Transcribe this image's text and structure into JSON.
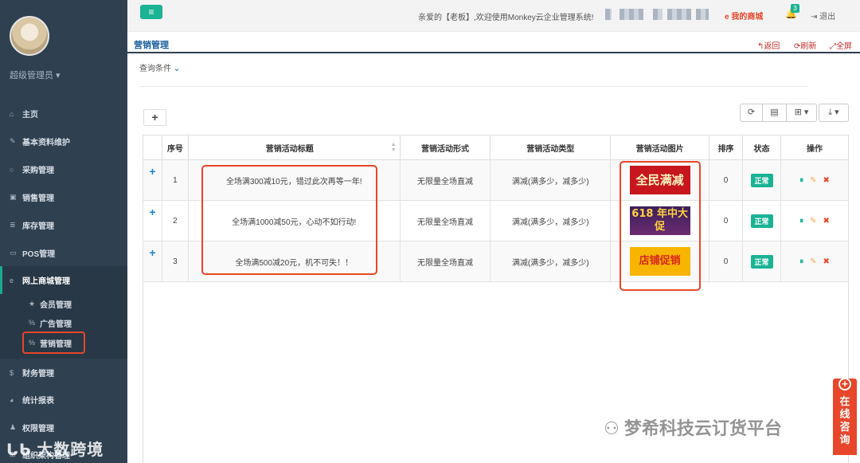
{
  "sidebar": {
    "role": "超级管理员",
    "items": [
      {
        "icon": "home-icon",
        "glyph": "⌂",
        "label": "主页"
      },
      {
        "icon": "pencil-icon",
        "glyph": "✎",
        "label": "基本资料维护"
      },
      {
        "icon": "circle-icon",
        "glyph": "○",
        "label": "采购管理"
      },
      {
        "icon": "money-icon",
        "glyph": "▣",
        "label": "销售管理"
      },
      {
        "icon": "database-icon",
        "glyph": "≣",
        "label": "库存管理"
      },
      {
        "icon": "desktop-icon",
        "glyph": "▭",
        "label": "POS管理"
      },
      {
        "icon": "ie-icon",
        "glyph": "e",
        "label": "网上商城管理"
      },
      {
        "icon": "dollar-icon",
        "glyph": "$",
        "label": "财务管理"
      },
      {
        "icon": "pie-chart-icon",
        "glyph": "◕",
        "label": "统计报表"
      },
      {
        "icon": "user-icon",
        "glyph": "♟",
        "label": "权限管理"
      },
      {
        "icon": "sitemap-icon",
        "glyph": "⊞",
        "label": "组织架构管理"
      }
    ],
    "subitems": [
      {
        "icon": "star-icon",
        "glyph": "★",
        "label": "会员管理"
      },
      {
        "icon": "link-icon",
        "glyph": "%",
        "label": "广告管理"
      },
      {
        "icon": "link-icon",
        "glyph": "%",
        "label": "营销管理"
      }
    ],
    "watermark": "大数跨境"
  },
  "topbar": {
    "menu_glyph": "≡",
    "welcome": "亲爱的【老板】,欢迎使用Monkey云企业管理系统!",
    "mall_link": "e 我的商城",
    "badge": "3",
    "logout": "⇥ 退出"
  },
  "breadcrumb": {
    "title": "营销管理",
    "back": "↰返回",
    "refresh": "⟳刷新",
    "fullscreen": "⤢全屏"
  },
  "query": {
    "label": "查询条件",
    "chevron": "⌄"
  },
  "toolbar": {
    "add": "+",
    "refresh": "⟳",
    "list": "▤",
    "columns": "⊞ ▾",
    "export": "⤓ ▾"
  },
  "table": {
    "headers": [
      "",
      "序号",
      "营销活动标题",
      "营销活动形式",
      "营销活动类型",
      "营销活动图片",
      "排序",
      "状态",
      "操作"
    ],
    "rows": [
      {
        "no": "1",
        "title": "全场满300减10元，错过此次再等一年!",
        "form": "无限量全场直减",
        "type": "满减(满多少，减多少)",
        "banner": "全民满减",
        "sort": "0",
        "status": "正常"
      },
      {
        "no": "2",
        "title": "全场满1000减50元，心动不如行动!",
        "form": "无限量全场直减",
        "type": "满减(满多少，减多少)",
        "banner": "618 年中大促",
        "sort": "0",
        "status": "正常"
      },
      {
        "no": "3",
        "title": "全场满500减20元，机不可失！！",
        "form": "无限量全场直减",
        "type": "满减(满多少，减多少)",
        "banner": "店铺促销",
        "sort": "0",
        "status": "正常"
      }
    ],
    "ops": {
      "pause": "⏸",
      "edit": "✎",
      "delete": "✖"
    },
    "expand": "+"
  },
  "watermark_right": "梦希科技云订货平台",
  "chat": {
    "plus": "+",
    "label": "在线咨询"
  },
  "colors": {
    "sidebar": "#2f4050",
    "accent": "#1ab394",
    "highlight": "#e8462a",
    "link": "#1c84c6"
  }
}
